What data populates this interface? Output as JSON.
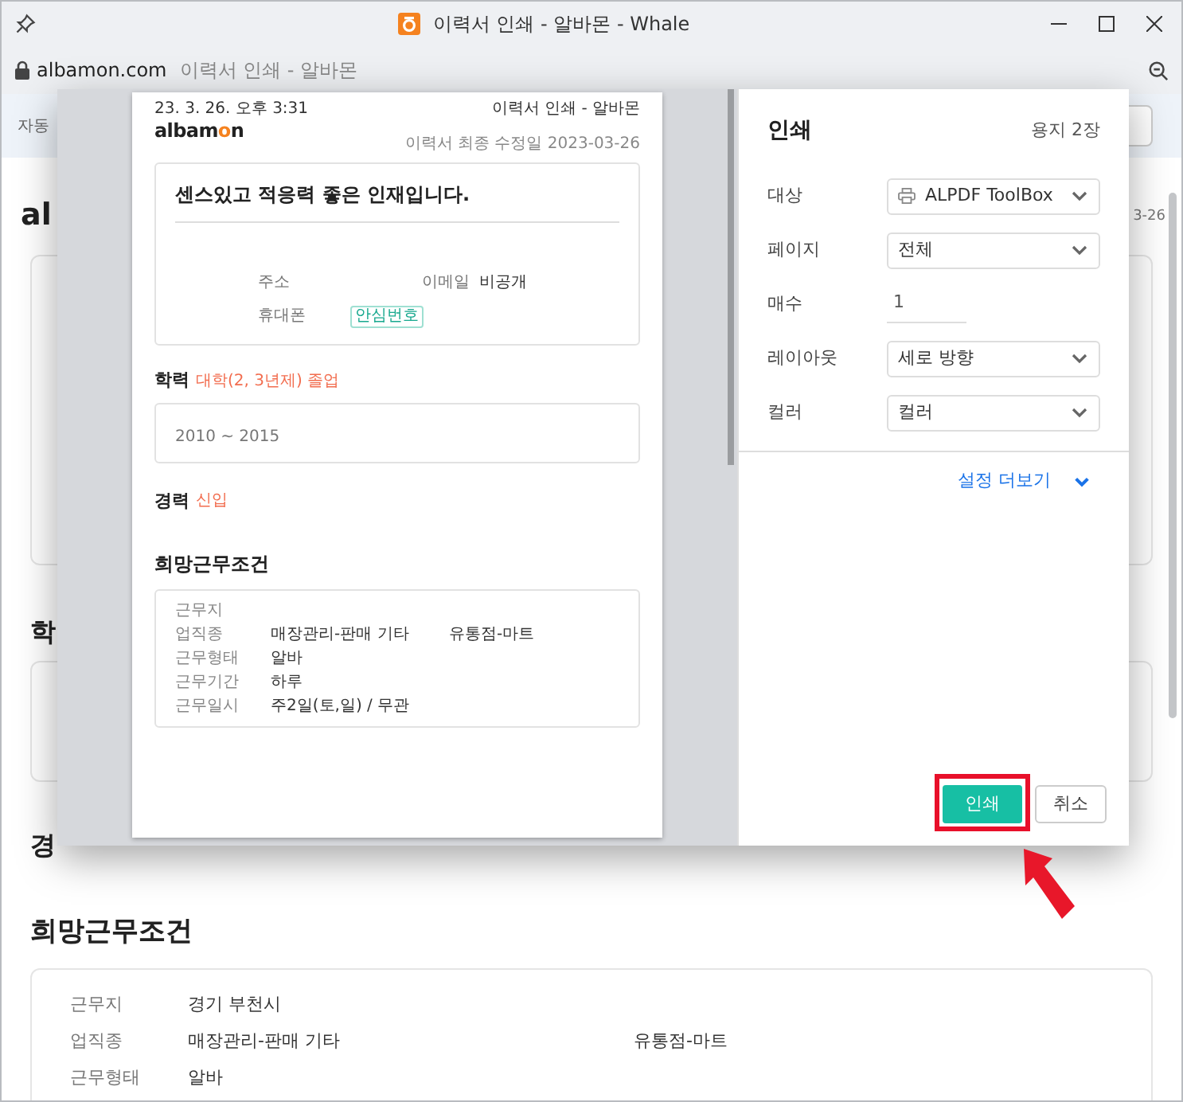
{
  "window": {
    "title": "이력서 인쇄 - 알바몬 - Whale"
  },
  "address_bar": {
    "domain": "albamon.com",
    "page_title": "이력서 인쇄 - 알바몬"
  },
  "background_page": {
    "banner_text": "자동",
    "heading": "al",
    "date": "3-26",
    "section_1": "학",
    "section_2": "경",
    "section_3": "희망근무조건",
    "rows": [
      {
        "label": "근무지",
        "value": "경기 부천시"
      },
      {
        "label": "업직종",
        "value": "매장관리-판매 기타",
        "value_2": "유통점-마트"
      },
      {
        "label": "근무형태",
        "value": "알바"
      }
    ]
  },
  "print_preview": {
    "datetime": "23. 3. 26. 오후 3:31",
    "doc_title": "이력서 인쇄 - 알바몬",
    "modified": "이력서 최종 수정일 2023-03-26",
    "logo_parts": [
      {
        "text": "albam",
        "color": "#222222"
      },
      {
        "text": "o",
        "color": "#f5821f"
      },
      {
        "text": "n",
        "color": "#222222"
      }
    ],
    "headline": "센스있고 적응력 좋은 인재입니다.",
    "address_label": "주소",
    "email_label": "이메일",
    "email_value": "비공개",
    "phone_label": "휴대폰",
    "phone_badge": "안심번호",
    "education_title": "학력",
    "education_note": "대학(2, 3년제) 졸업",
    "education_period": "2010 ~ 2015",
    "career_title": "경력",
    "career_note": "신입",
    "conditions_title": "희망근무조건",
    "conditions": [
      {
        "label": "근무지"
      },
      {
        "label": "업직종",
        "value": "매장관리-판매 기타",
        "value_2": "유통점-마트"
      },
      {
        "label": "근무형태",
        "value": "알바"
      },
      {
        "label": "근무기간",
        "value": "하루"
      },
      {
        "label": "근무일시",
        "value": "주2일(토,일) / 무관"
      }
    ]
  },
  "print_settings": {
    "title": "인쇄",
    "sheets": "용지 2장",
    "fields": [
      {
        "label": "대상",
        "kind": "printer-select",
        "value": "ALPDF ToolBox"
      },
      {
        "label": "페이지",
        "kind": "select",
        "value": "전체"
      },
      {
        "label": "매수",
        "kind": "number",
        "value": "1"
      },
      {
        "label": "레이아웃",
        "kind": "select",
        "value": "세로 방향"
      },
      {
        "label": "컬러",
        "kind": "select",
        "value": "컬러"
      }
    ],
    "more_settings": "설정 더보기",
    "buttons": [
      {
        "label": "인쇄",
        "kind": "primary",
        "highlighted": true
      },
      {
        "label": "취소",
        "kind": "secondary",
        "highlighted": false
      }
    ]
  }
}
